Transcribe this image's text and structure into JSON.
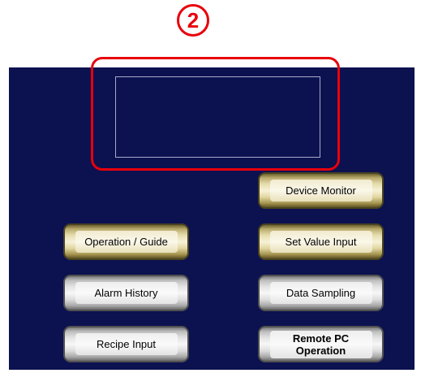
{
  "marker": {
    "label": "2"
  },
  "screen": {
    "buttons": {
      "device_monitor": "Device Monitor",
      "operation_guide": "Operation / Guide",
      "set_value_input": "Set Value Input",
      "alarm_history": "Alarm History",
      "data_sampling": "Data Sampling",
      "recipe_input": "Recipe Input",
      "remote_pc_line1": "Remote PC",
      "remote_pc_line2": "Operation"
    }
  },
  "colors": {
    "panel_background": "#0c1150",
    "highlight": "#e8000b",
    "gold_button": "#e5dcac",
    "silver_button": "#e2e2e2"
  }
}
